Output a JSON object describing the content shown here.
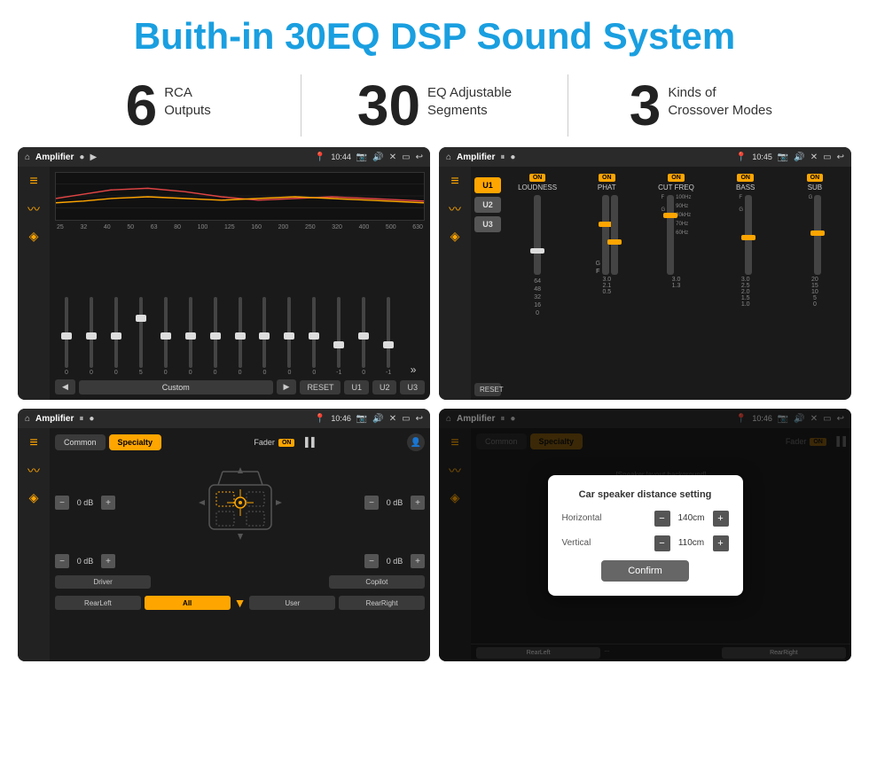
{
  "header": {
    "title": "Buith-in 30EQ DSP Sound System"
  },
  "stats": [
    {
      "number": "6",
      "label": "RCA\nOutputs"
    },
    {
      "number": "30",
      "label": "EQ Adjustable\nSegments"
    },
    {
      "number": "3",
      "label": "Kinds of\nCrossover Modes"
    }
  ],
  "screens": [
    {
      "id": "screen1",
      "status": {
        "title": "Amplifier",
        "time": "10:44"
      },
      "type": "eq"
    },
    {
      "id": "screen2",
      "status": {
        "title": "Amplifier",
        "time": "10:45"
      },
      "type": "crossover"
    },
    {
      "id": "screen3",
      "status": {
        "title": "Amplifier",
        "time": "10:46"
      },
      "type": "fader"
    },
    {
      "id": "screen4",
      "status": {
        "title": "Amplifier",
        "time": "10:46"
      },
      "type": "dialog"
    }
  ],
  "eq": {
    "frequencies": [
      "25",
      "32",
      "40",
      "50",
      "63",
      "80",
      "100",
      "125",
      "160",
      "200",
      "250",
      "320",
      "400",
      "500",
      "630"
    ],
    "values": [
      "0",
      "0",
      "0",
      "5",
      "0",
      "0",
      "0",
      "0",
      "0",
      "0",
      "0",
      "-1",
      "0",
      "-1"
    ],
    "buttons": [
      "Custom",
      "RESET",
      "U1",
      "U2",
      "U3"
    ]
  },
  "crossover": {
    "presets": [
      "U1",
      "U2",
      "U3"
    ],
    "columns": [
      "LOUDNESS",
      "PHAT",
      "CUT FREQ",
      "BASS",
      "SUB"
    ],
    "on_labels": [
      "ON",
      "ON",
      "ON",
      "ON",
      "ON"
    ]
  },
  "fader": {
    "tabs": [
      "Common",
      "Specialty"
    ],
    "fader_label": "Fader",
    "on_label": "ON",
    "left_dbs": [
      "0 dB",
      "0 dB"
    ],
    "right_dbs": [
      "0 dB",
      "0 dB"
    ],
    "presets": [
      "Driver",
      "",
      "",
      "",
      "Copilot"
    ],
    "bottom_presets": [
      "RearLeft",
      "All",
      "",
      "User",
      "RearRight"
    ]
  },
  "dialog": {
    "title": "Car speaker distance setting",
    "horizontal_label": "Horizontal",
    "horizontal_value": "140cm",
    "vertical_label": "Vertical",
    "vertical_value": "110cm",
    "confirm_label": "Confirm"
  },
  "colors": {
    "accent": "#ffa500",
    "blue": "#1a9fe0",
    "dark_bg": "#1a1a1a",
    "sidebar_bg": "#222"
  }
}
